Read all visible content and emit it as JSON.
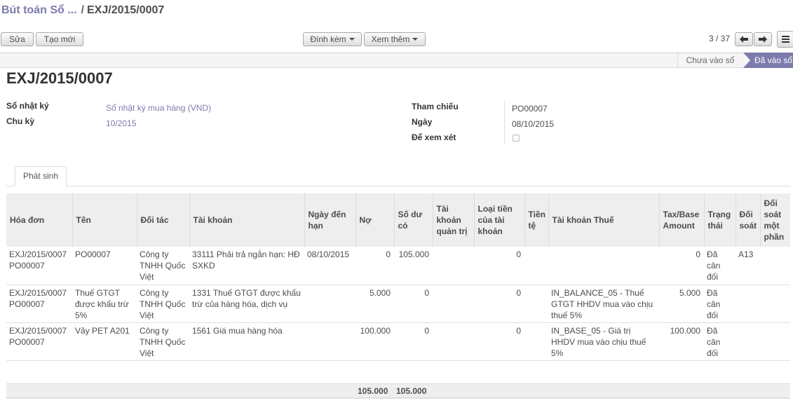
{
  "breadcrumb": {
    "parent": "Bút toán Sổ ...",
    "separator": "/",
    "current": "EXJ/2015/0007"
  },
  "toolbar": {
    "edit": "Sửa",
    "create": "Tạo mới",
    "attach": "Đính kèm",
    "more": "Xem thêm"
  },
  "pager": {
    "text": "3 / 37",
    "prev_icon": "arrow-left-icon",
    "next_icon": "arrow-right-icon",
    "list_icon": "list-icon"
  },
  "status": {
    "draft": "Chưa vào sổ",
    "posted": "Đã vào sổ",
    "active_color": "#7c7bad"
  },
  "record": {
    "title": "EXJ/2015/0007",
    "journal_label": "Sổ nhật ký",
    "journal_value": "Sổ nhật ký mua hàng (VND)",
    "period_label": "Chu kỳ",
    "period_value": "10/2015",
    "ref_label": "Tham chiếu",
    "ref_value": "PO00007",
    "date_label": "Ngày",
    "date_value": "08/10/2015",
    "review_label": "Để xem xét",
    "review_checked": false
  },
  "tab": {
    "label": "Phát sinh"
  },
  "lines": {
    "headers": [
      "Hóa đơn",
      "Tên",
      "Đối tác",
      "Tài khoản",
      "Ngày đến hạn",
      "Nợ",
      "Số dư có",
      "Tài khoản quản trị",
      "Loại tiền của tài khoản",
      "Tiền tệ",
      "Tài khoản Thuế",
      "Tax/Base Amount",
      "Trạng thái",
      "Đối soát",
      "Đối soát một phần"
    ],
    "rows": [
      {
        "invoice": "EXJ/2015/0007 PO00007",
        "name": "PO00007",
        "partner": "Công ty TNHH Quốc Việt",
        "account": "33111 Phải trả ngắn hạn: HĐ SXKD",
        "due": "08/10/2015",
        "debit": "0",
        "credit": "105.000",
        "analytic": "",
        "amount_currency": "0",
        "currency": "",
        "tax_code": "",
        "tax_amount": "0",
        "state": "Đã cân đối",
        "reconcile": "A13",
        "partial": ""
      },
      {
        "invoice": "EXJ/2015/0007 PO00007",
        "name": "Thuế GTGT được khấu trừ 5%",
        "partner": "Công ty TNHH Quốc Việt",
        "account": "1331 Thuế GTGT được khấu trừ của hàng hóa, dịch vụ",
        "due": "",
        "debit": "5.000",
        "credit": "0",
        "analytic": "",
        "amount_currency": "0",
        "currency": "",
        "tax_code": "IN_BALANCE_05 - Thuế GTGT HHDV mua vào chịu thuế 5%",
        "tax_amount": "5.000",
        "state": "Đã cân đối",
        "reconcile": "",
        "partial": ""
      },
      {
        "invoice": "EXJ/2015/0007 PO00007",
        "name": "Vảy PET A201",
        "partner": "Công ty TNHH Quốc Việt",
        "account": "1561 Giá mua hàng hóa",
        "due": "",
        "debit": "100.000",
        "credit": "0",
        "analytic": "",
        "amount_currency": "0",
        "currency": "",
        "tax_code": "IN_BASE_05 - Giá trị HHDV mua vào chịu thuế 5%",
        "tax_amount": "100.000",
        "state": "Đã cân đối",
        "reconcile": "",
        "partial": ""
      }
    ],
    "totals": {
      "debit": "105.000",
      "credit": "105.000"
    }
  }
}
